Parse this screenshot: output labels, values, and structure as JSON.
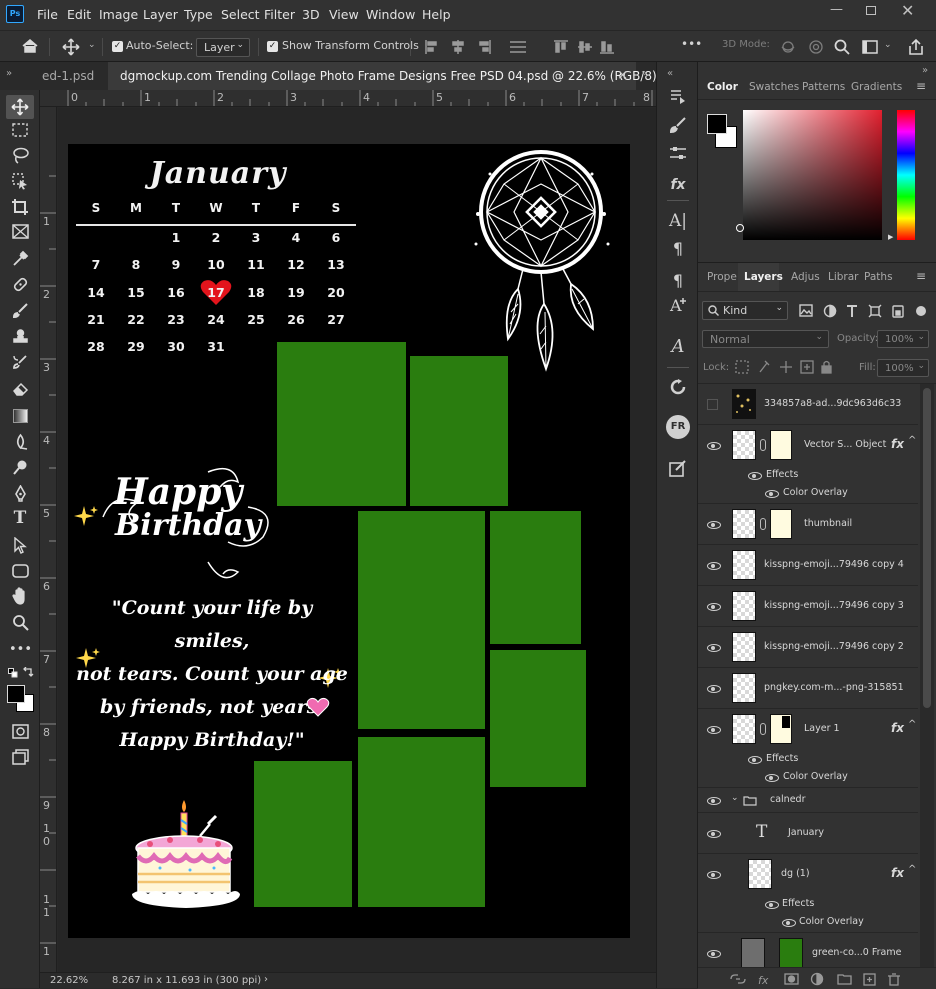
{
  "app": {
    "logo": "Ps"
  },
  "menubar": {
    "items": [
      "File",
      "Edit",
      "Image",
      "Layer",
      "Type",
      "Select",
      "Filter",
      "3D",
      "View",
      "Window",
      "Help"
    ]
  },
  "options": {
    "auto_select_label": "Auto-Select:",
    "auto_select_target": "Layer",
    "show_transform_label": "Show Transform Controls",
    "mode_3d_label": "3D Mode:",
    "more_label": "•••"
  },
  "tabs": [
    {
      "label": "ed-1.psd",
      "active": false
    },
    {
      "label": "dgmockup.com Trending Collage Photo Frame Designs Free PSD 04.psd @ 22.6% (RGB/8) *",
      "active": true
    }
  ],
  "tab_close": "×",
  "ruler": {
    "top": [
      "0",
      "1",
      "2",
      "3",
      "4",
      "5",
      "6",
      "7",
      "8"
    ],
    "left": [
      "1",
      "2",
      "3",
      "4",
      "5",
      "6",
      "7",
      "8",
      "9",
      "1\n0",
      "1\n1",
      "1"
    ]
  },
  "status": {
    "zoom": "22.62%",
    "doc_info": "8.267 in x 11.693 in (300 ppi)",
    "arrow": "›"
  },
  "canvas": {
    "month": "January",
    "weekdays": [
      "S",
      "M",
      "T",
      "W",
      "T",
      "F",
      "S"
    ],
    "weeks": [
      [
        "",
        "",
        "1",
        "2",
        "3",
        "4",
        "6"
      ],
      [
        "7",
        "8",
        "9",
        "10",
        "11",
        "12",
        "13"
      ],
      [
        "14",
        "15",
        "16",
        "17",
        "18",
        "19",
        "20"
      ],
      [
        "21",
        "22",
        "23",
        "24",
        "25",
        "26",
        "27"
      ],
      [
        "28",
        "29",
        "30",
        "31",
        "",
        "",
        ""
      ]
    ],
    "highlight_day": "17",
    "heart_color": "#e3141c",
    "photo_color": "#2a7d0f",
    "happy_line1": "Happy",
    "happy_line2": "Birthday",
    "quote_lines": [
      "\"Count your life by smiles,",
      "not tears. Count your age",
      "by friends, not years.",
      "Happy Birthday!\""
    ]
  },
  "color_panel": {
    "tabs": [
      "Color",
      "Swatches",
      "Patterns",
      "Gradients"
    ],
    "active_tab": "Color",
    "hue_color": "#e2202f",
    "foreground": "#000000",
    "background": "#ffffff"
  },
  "layers_panel": {
    "tabs": [
      "Prope",
      "Layers",
      "Adjus",
      "Librar",
      "Paths"
    ],
    "active_tab": "Layers",
    "filter_kind": "Kind",
    "blend_mode": "Normal",
    "opacity_label": "Opacity:",
    "opacity_value": "100%",
    "lock_label": "Lock:",
    "fill_label": "Fill:",
    "fill_value": "100%",
    "effects_label": "Effects",
    "color_overlay_label": "Color Overlay",
    "layers": [
      {
        "name": "334857a8-ad...9dc963d6c33"
      },
      {
        "name": "Vector S... Object"
      },
      {
        "name": "thumbnail"
      },
      {
        "name": "kisspng-emoji...79496 copy 4"
      },
      {
        "name": "kisspng-emoji...79496 copy 3"
      },
      {
        "name": "kisspng-emoji...79496 copy 2"
      },
      {
        "name": "pngkey.com-m...-png-315851"
      },
      {
        "name": "Layer 1"
      },
      {
        "name": "calnedr"
      },
      {
        "name": "January"
      },
      {
        "name": "dg (1)"
      },
      {
        "name": "green-co...0 Frame"
      }
    ],
    "fx_symbol": "fx",
    "text_layer_glyph": "T"
  }
}
